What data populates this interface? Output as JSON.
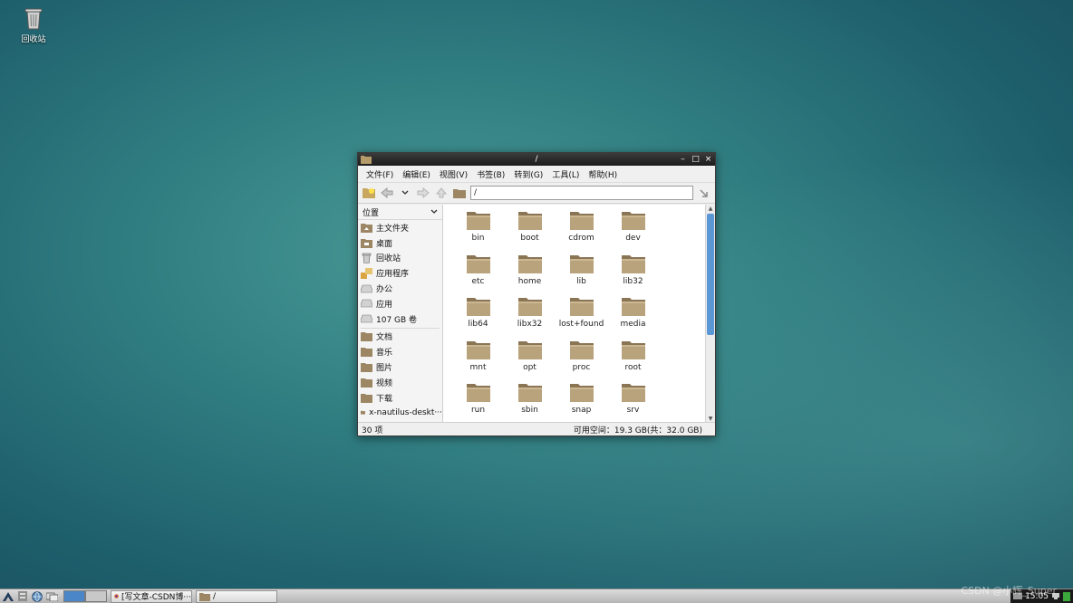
{
  "desktop": {
    "icons": [
      {
        "label": "回收站",
        "icon": "trash-icon"
      }
    ]
  },
  "window": {
    "title": "/",
    "controls": {
      "minimize": "–",
      "maximize": "□",
      "close": "×"
    },
    "menu": [
      "文件(F)",
      "编辑(E)",
      "视图(V)",
      "书签(B)",
      "转到(G)",
      "工具(L)",
      "帮助(H)"
    ],
    "path": "/",
    "sidebar": {
      "header": "位置",
      "places": [
        {
          "label": "主文件夹",
          "icon": "home-folder-icon"
        },
        {
          "label": "桌面",
          "icon": "desktop-folder-icon"
        },
        {
          "label": "回收站",
          "icon": "trash-icon"
        },
        {
          "label": "应用程序",
          "icon": "applications-icon"
        },
        {
          "label": "办公",
          "icon": "drive-icon"
        },
        {
          "label": "应用",
          "icon": "drive-icon"
        },
        {
          "label": "107 GB 卷",
          "icon": "drive-icon"
        }
      ],
      "bookmarks": [
        {
          "label": "文档",
          "icon": "folder-icon"
        },
        {
          "label": "音乐",
          "icon": "folder-icon"
        },
        {
          "label": "图片",
          "icon": "folder-icon"
        },
        {
          "label": "视频",
          "icon": "folder-icon"
        },
        {
          "label": "下载",
          "icon": "folder-icon"
        },
        {
          "label": "x-nautilus-deskt···",
          "icon": "folder-icon"
        }
      ]
    },
    "files": [
      "bin",
      "boot",
      "cdrom",
      "dev",
      "etc",
      "home",
      "lib",
      "lib32",
      "lib64",
      "libx32",
      "lost+found",
      "media",
      "mnt",
      "opt",
      "proc",
      "root",
      "run",
      "sbin",
      "snap",
      "srv"
    ],
    "status": {
      "count": "30 项",
      "free_space": "可用空间：19.3 GB(共：32.0 GB)"
    }
  },
  "taskbar": {
    "tasks": [
      {
        "label": "[写文章-CSDN博···",
        "icon": "firefox-icon"
      },
      {
        "label": "/",
        "icon": "folder-icon"
      }
    ],
    "clock": "15:05"
  },
  "watermark": "CSDN @小辉_Super"
}
